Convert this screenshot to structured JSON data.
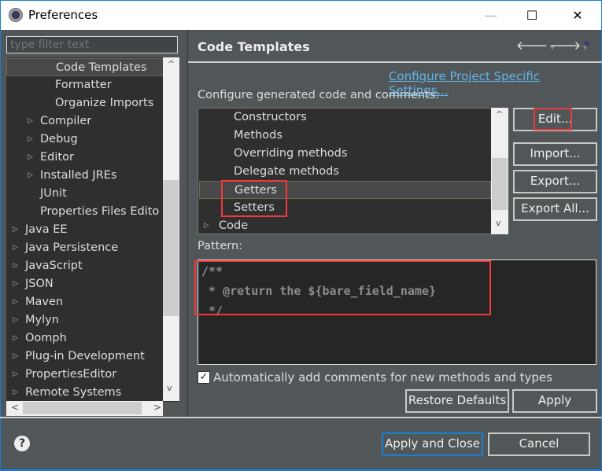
{
  "window": {
    "title": "Preferences",
    "minimize": "—",
    "maximize": "☐",
    "close": "✕"
  },
  "filter": {
    "placeholder": "type filter text"
  },
  "nav_tree": [
    {
      "label": "Code Templates",
      "level": 2,
      "expandable": false,
      "selected": true
    },
    {
      "label": "Formatter",
      "level": 2,
      "expandable": false
    },
    {
      "label": "Organize Imports",
      "level": 2,
      "expandable": false
    },
    {
      "label": "Compiler",
      "level": 1,
      "expandable": true
    },
    {
      "label": "Debug",
      "level": 1,
      "expandable": true
    },
    {
      "label": "Editor",
      "level": 1,
      "expandable": true
    },
    {
      "label": "Installed JREs",
      "level": 1,
      "expandable": true
    },
    {
      "label": "JUnit",
      "level": 1,
      "expandable": false
    },
    {
      "label": "Properties Files Edito",
      "level": 1,
      "expandable": false
    },
    {
      "label": "Java EE",
      "level": 0,
      "expandable": true
    },
    {
      "label": "Java Persistence",
      "level": 0,
      "expandable": true
    },
    {
      "label": "JavaScript",
      "level": 0,
      "expandable": true
    },
    {
      "label": "JSON",
      "level": 0,
      "expandable": true
    },
    {
      "label": "Maven",
      "level": 0,
      "expandable": true
    },
    {
      "label": "Mylyn",
      "level": 0,
      "expandable": true
    },
    {
      "label": "Oomph",
      "level": 0,
      "expandable": true
    },
    {
      "label": "Plug-in Development",
      "level": 0,
      "expandable": true
    },
    {
      "label": "PropertiesEditor",
      "level": 0,
      "expandable": true
    },
    {
      "label": "Remote Systems",
      "level": 0,
      "expandable": true
    }
  ],
  "page": {
    "title": "Code Templates",
    "link": "Configure Project Specific Settings...",
    "configure_label": "Configure generated code and comments:",
    "pattern_label": "Pattern:"
  },
  "templates": [
    {
      "label": "Constructors",
      "level": 1
    },
    {
      "label": "Methods",
      "level": 1
    },
    {
      "label": "Overriding methods",
      "level": 1
    },
    {
      "label": "Delegate methods",
      "level": 1
    },
    {
      "label": "Getters",
      "level": 1,
      "selected": true,
      "highlighted": true
    },
    {
      "label": "Setters",
      "level": 1,
      "highlighted": true
    },
    {
      "label": "Code",
      "level": 0,
      "expandable": true
    }
  ],
  "side_buttons": {
    "edit": "Edit...",
    "import": "Import...",
    "export": "Export...",
    "export_all": "Export All..."
  },
  "pattern": {
    "line1": "/**",
    "line2": " * @return the ${bare_field_name}",
    "line3": " */"
  },
  "auto_comments": {
    "label": "Automatically add comments for new methods and types",
    "checked": true
  },
  "buttons": {
    "restore": "Restore Defaults",
    "apply": "Apply",
    "apply_close": "Apply and Close",
    "cancel": "Cancel",
    "help": "?"
  },
  "colors": {
    "highlight": "#f03a3a",
    "link": "#62b4e8",
    "accent": "#1a7fd4"
  }
}
